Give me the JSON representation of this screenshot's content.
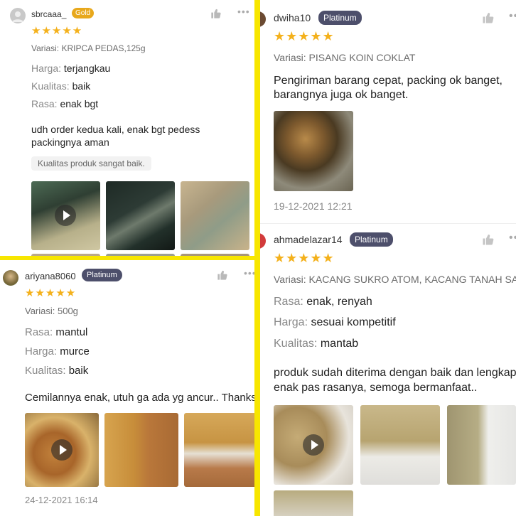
{
  "colors": {
    "background": "#f7e600",
    "star": "#f4b11c",
    "gold_badge": "#e8a81c",
    "platinum_badge": "#4d4f6b"
  },
  "stars_glyph": "★★★★★",
  "more_glyph": "•••",
  "reviews": {
    "tl": {
      "username": "sbrcaaa_",
      "badge": "Gold",
      "rating": 5,
      "variant": "Variasi: KRIPCA PEDAS,125g",
      "attrs": [
        {
          "label": "Harga:",
          "value": "terjangkau"
        },
        {
          "label": "Kualitas:",
          "value": "baik"
        },
        {
          "label": "Rasa:",
          "value": "enak bgt"
        }
      ],
      "comment": "udh order kedua kali, enak bgt pedess packingnya aman",
      "tag": "Kualitas produk sangat baik.",
      "media": [
        "video-thumbnail",
        "photo-thumbnail",
        "photo-thumbnail"
      ]
    },
    "tr1": {
      "username": "dwiha10",
      "badge": "Platinum",
      "rating": 5,
      "variant": "Variasi: PISANG KOIN COKLAT",
      "comment": "Pengiriman barang cepat, packing ok banget, barangnya juga ok banget.",
      "media": [
        "photo-thumbnail"
      ],
      "timestamp": "19-12-2021 12:21"
    },
    "tr2": {
      "username": "ahmadelazar14",
      "badge": "Platinum",
      "rating": 5,
      "variant": "Variasi: KACANG SUKRO ATOM, KACANG TANAH SAN...",
      "attrs": [
        {
          "label": "Rasa:",
          "value": "enak, renyah"
        },
        {
          "label": "Harga:",
          "value": "sesuai kompetitif"
        },
        {
          "label": "Kualitas:",
          "value": "mantab"
        }
      ],
      "comment_line1": "produk sudah diterima dengan baik dan lengkap",
      "comment_line2": "enak pas rasanya, semoga bermanfaat..",
      "media": [
        "video-thumbnail",
        "photo-thumbnail",
        "photo-thumbnail",
        "photo-thumbnail"
      ]
    },
    "bl": {
      "username": "ariyana8060",
      "badge": "Platinum",
      "rating": 5,
      "variant": "Variasi: 500g",
      "attrs": [
        {
          "label": "Rasa:",
          "value": "mantul"
        },
        {
          "label": "Harga:",
          "value": "murce"
        },
        {
          "label": "Kualitas:",
          "value": "baik"
        }
      ],
      "comment": "Cemilannya enak, utuh ga ada yg ancur.. Thanks",
      "media": [
        "video-thumbnail",
        "photo-thumbnail",
        "photo-thumbnail"
      ],
      "timestamp": "24-12-2021 16:14"
    }
  }
}
